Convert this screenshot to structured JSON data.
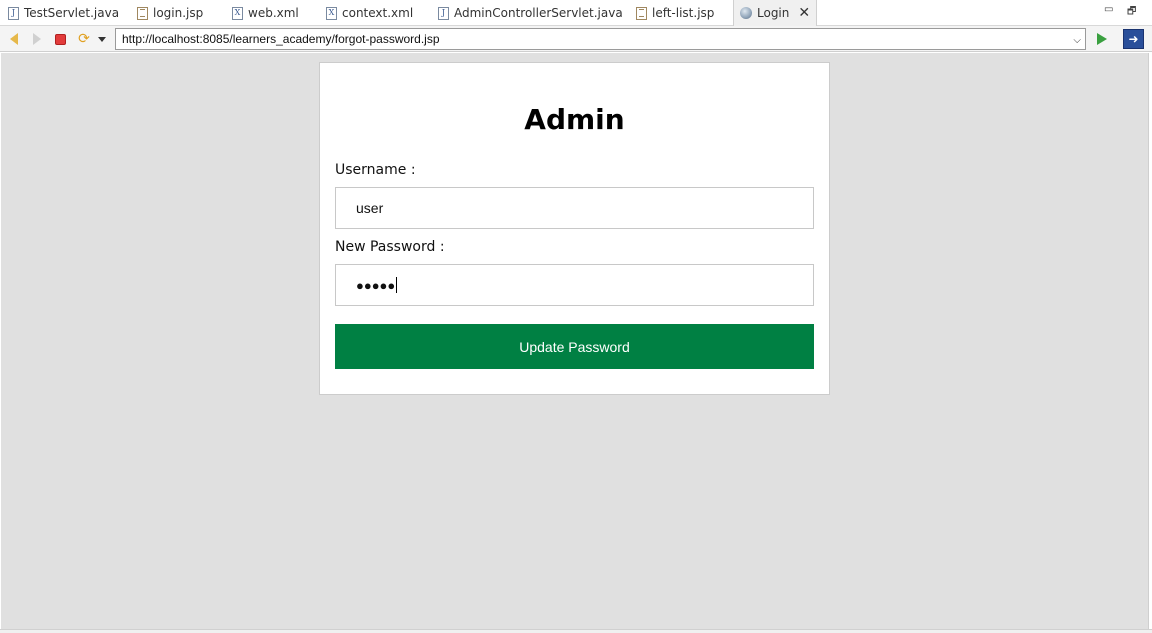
{
  "tabs": [
    {
      "label": "TestServlet.java",
      "icon": "java-file-icon",
      "icon_glyph": "J"
    },
    {
      "label": "login.jsp",
      "icon": "jsp-file-icon",
      "icon_glyph": ""
    },
    {
      "label": "web.xml",
      "icon": "xml-file-icon",
      "icon_glyph": "X"
    },
    {
      "label": "context.xml",
      "icon": "xml-file-icon",
      "icon_glyph": "X"
    },
    {
      "label": "AdminControllerServlet.java",
      "icon": "java-file-icon",
      "icon_glyph": "J"
    },
    {
      "label": "left-list.jsp",
      "icon": "jsp-file-icon",
      "icon_glyph": ""
    },
    {
      "label": "Login",
      "icon": "globe-icon",
      "active": true
    }
  ],
  "window_controls": {
    "minimize": "▭",
    "restore": "🗗"
  },
  "toolbar": {
    "url": "http://localhost:8085/learners_academy/forgot-password.jsp",
    "url_dropdown": "⌵",
    "ext_button": "➜"
  },
  "form": {
    "title": "Admin",
    "username_label": "Username :",
    "username_value": "user",
    "password_label": "New Password :",
    "password_value": "●●●●●",
    "submit_label": "Update Password"
  },
  "colors": {
    "accent": "#008043",
    "page_background": "#e0e0e0",
    "card_background": "#ffffff"
  }
}
